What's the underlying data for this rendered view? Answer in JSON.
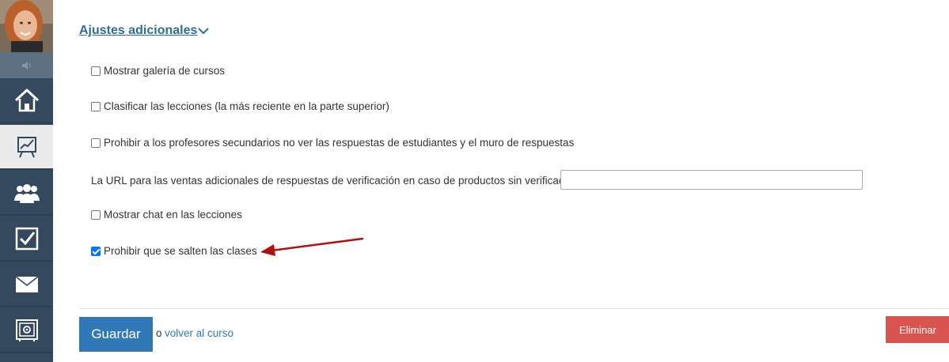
{
  "sidebar": {
    "items": [
      {
        "name": "home-icon"
      },
      {
        "name": "chart-board-icon",
        "active": true
      },
      {
        "name": "users-icon"
      },
      {
        "name": "checkbox-icon"
      },
      {
        "name": "mail-icon"
      },
      {
        "name": "safe-icon"
      }
    ]
  },
  "settings": {
    "section_title": "Ajustes adicionales",
    "options": [
      {
        "label": "Mostrar galería de cursos",
        "checked": false
      },
      {
        "label": "Clasificar las lecciones (la más reciente en la parte superior)",
        "checked": false
      },
      {
        "label": "Prohibir a los profesores secundarios no ver las respuestas de estudiantes y el muro de respuestas",
        "checked": false
      },
      {
        "label": "Mostrar chat en las lecciones",
        "checked": false
      },
      {
        "label": "Prohibir que se salten las clases",
        "checked": true
      }
    ],
    "url_label": "La URL para las ventas adicionales de respuestas de verificación en caso de productos sin verificación",
    "url_value": ""
  },
  "footer": {
    "save_label": "Guardar",
    "or_text": "o",
    "back_link": "volver al curso",
    "delete_label": "Eliminar"
  },
  "colors": {
    "sidebar": "#34495e",
    "link": "#2d6e96",
    "primary_button": "#3178b9",
    "danger_button": "#d9534f",
    "annotation_arrow": "#b01010"
  }
}
